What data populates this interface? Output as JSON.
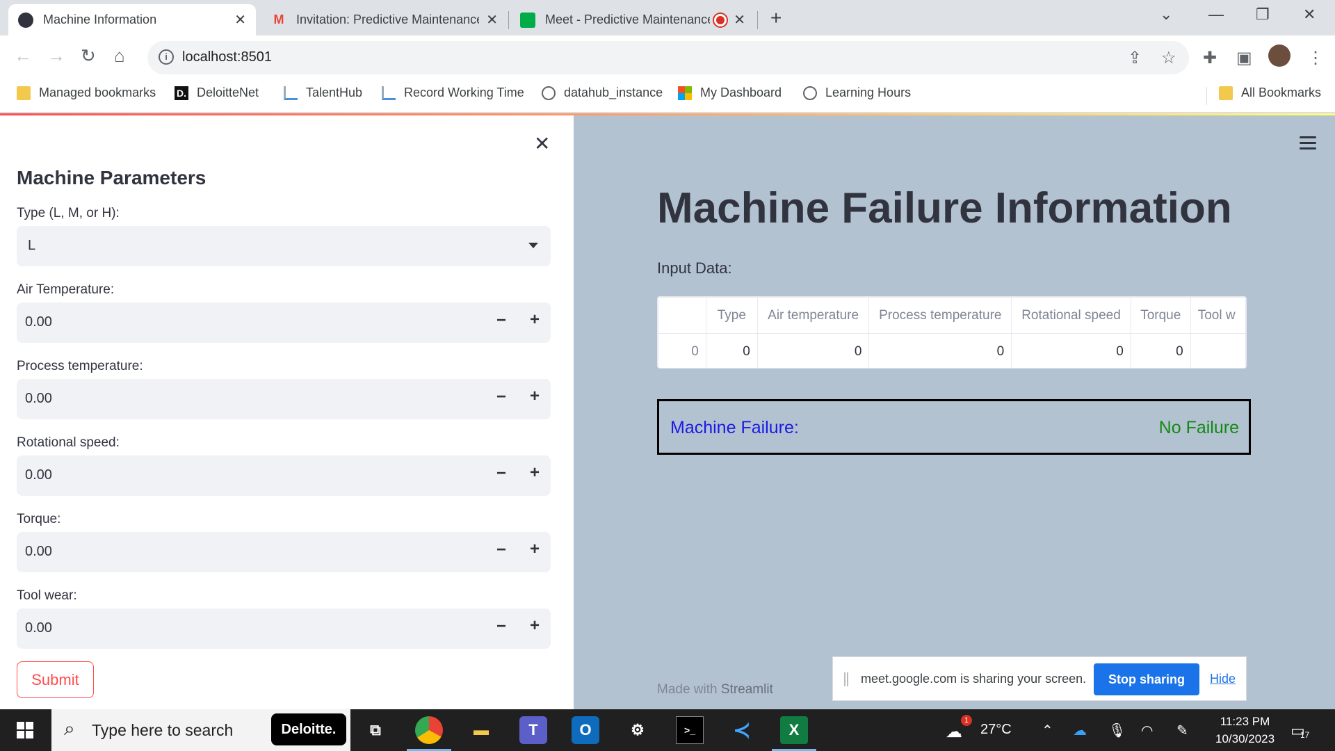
{
  "browser": {
    "tabs": [
      {
        "title": "Machine Information",
        "active": true
      },
      {
        "title": "Invitation: Predictive Maintenance"
      },
      {
        "title": "Meet - Predictive Maintenance"
      }
    ],
    "url": "localhost:8501",
    "bookmarks": [
      "Managed bookmarks",
      "DeloitteNet",
      "TalentHub",
      "Record Working Time",
      "datahub_instance",
      "My Dashboard",
      "Learning Hours"
    ],
    "all_bookmarks": "All Bookmarks"
  },
  "sidebar": {
    "title": "Machine Parameters",
    "type_label": "Type (L, M, or H):",
    "type_value": "L",
    "fields": [
      {
        "label": "Air Temperature:",
        "value": "0.00"
      },
      {
        "label": "Process temperature:",
        "value": "0.00"
      },
      {
        "label": "Rotational speed:",
        "value": "0.00"
      },
      {
        "label": "Torque:",
        "value": "0.00"
      },
      {
        "label": "Tool wear:",
        "value": "0.00"
      }
    ],
    "submit": "Submit"
  },
  "main": {
    "title": "Machine Failure Information",
    "input_label": "Input Data:",
    "table": {
      "columns": [
        "",
        "Type",
        "Air temperature",
        "Process temperature",
        "Rotational speed",
        "Torque",
        "Tool w"
      ],
      "rows": [
        [
          "0",
          "0",
          "0",
          "0",
          "0",
          "0",
          ""
        ]
      ]
    },
    "result_label": "Machine Failure:",
    "result_value": "No Failure",
    "made_with": "Made with",
    "made_with_brand": "Streamlit"
  },
  "share_bar": {
    "message": "meet.google.com is sharing your screen.",
    "stop": "Stop sharing",
    "hide": "Hide"
  },
  "taskbar": {
    "search_placeholder": "Type here to search",
    "deloitte": "Deloitte.",
    "weather_temp": "27°C",
    "weather_badge": "1",
    "time": "11:23 PM",
    "date": "10/30/2023",
    "notifications": "17"
  }
}
